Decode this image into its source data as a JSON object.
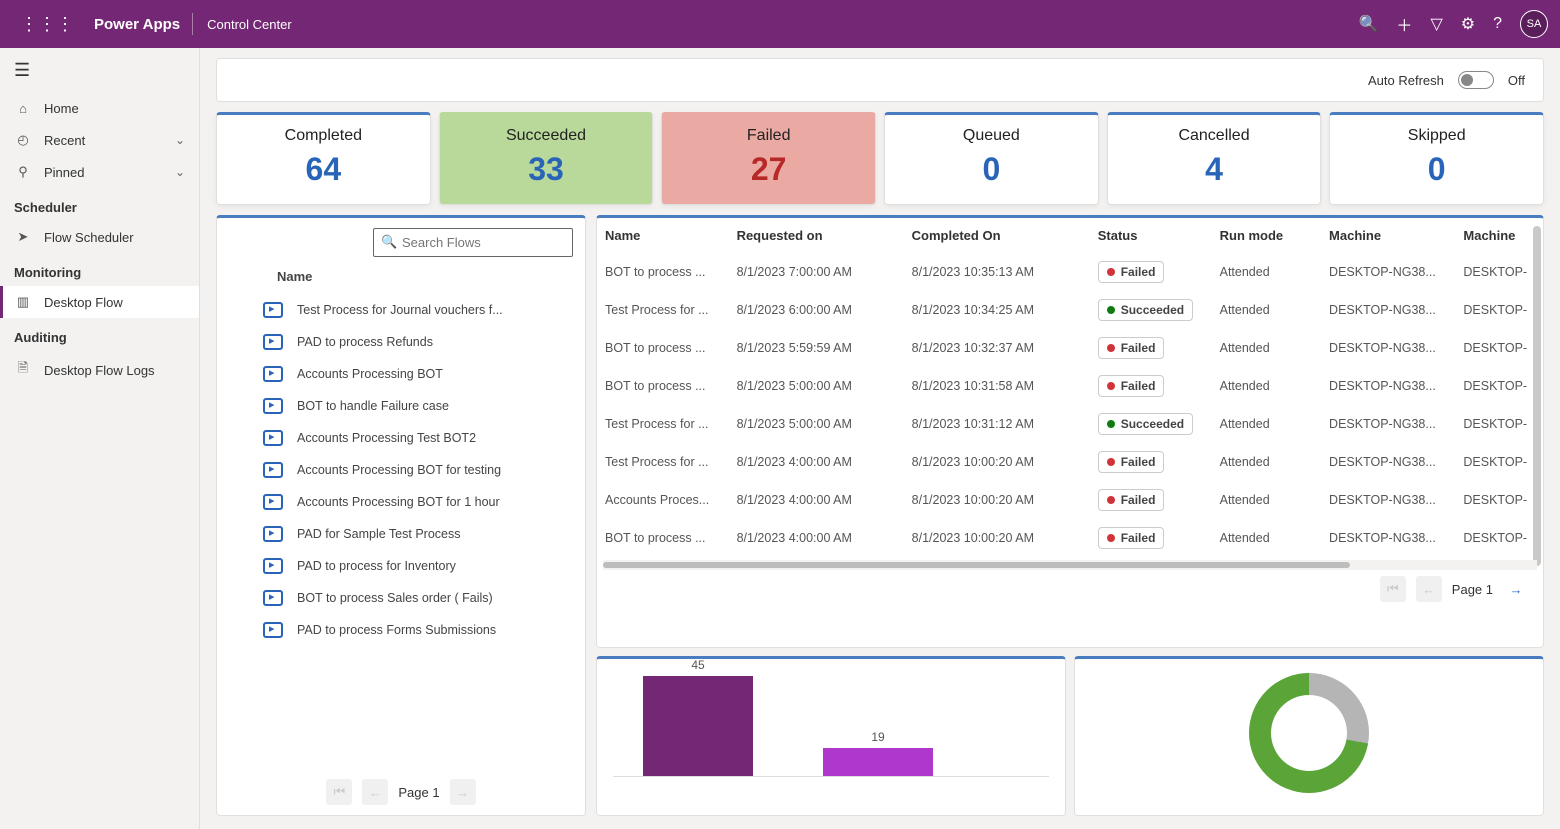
{
  "topbar": {
    "app_name": "Power Apps",
    "page_name": "Control Center",
    "avatar": "SA"
  },
  "nav": {
    "items": [
      {
        "icon": "⌂",
        "label": "Home",
        "chevron": false
      },
      {
        "icon": "◴",
        "label": "Recent",
        "chevron": true
      },
      {
        "icon": "⚲",
        "label": "Pinned",
        "chevron": true
      }
    ],
    "sections": [
      {
        "title": "Scheduler",
        "items": [
          {
            "icon": "➤",
            "label": "Flow Scheduler"
          }
        ]
      },
      {
        "title": "Monitoring",
        "items": [
          {
            "icon": "▥",
            "label": "Desktop Flow",
            "selected": true
          }
        ]
      },
      {
        "title": "Auditing",
        "items": [
          {
            "icon": "🗎",
            "label": "Desktop Flow Logs"
          }
        ]
      }
    ]
  },
  "refresh": {
    "label": "Auto Refresh",
    "state": "Off"
  },
  "kpis": [
    {
      "title": "Completed",
      "value": "64",
      "cls": ""
    },
    {
      "title": "Succeeded",
      "value": "33",
      "cls": "green"
    },
    {
      "title": "Failed",
      "value": "27",
      "cls": "red"
    },
    {
      "title": "Queued",
      "value": "0",
      "cls": ""
    },
    {
      "title": "Cancelled",
      "value": "4",
      "cls": ""
    },
    {
      "title": "Skipped",
      "value": "0",
      "cls": ""
    }
  ],
  "search": {
    "placeholder": "Search Flows"
  },
  "flows_header": "Name",
  "flows": [
    "Test Process for Journal vouchers f...",
    "PAD to process Refunds",
    "Accounts Processing BOT",
    "BOT to handle Failure case",
    "Accounts Processing Test BOT2",
    "Accounts Processing BOT for testing",
    "Accounts Processing BOT for 1 hour",
    "PAD for Sample Test Process",
    "PAD to process for Inventory",
    "BOT to process Sales order ( Fails)",
    "PAD to process Forms Submissions"
  ],
  "pager_left": {
    "page_label": "Page 1"
  },
  "table": {
    "headers": [
      "Name",
      "Requested on",
      "Completed On",
      "Status",
      "Run mode",
      "Machine",
      "Machine"
    ],
    "rows": [
      {
        "name": "BOT to process ...",
        "req": "8/1/2023 7:00:00 AM",
        "comp": "8/1/2023 10:35:13 AM",
        "status": "Failed",
        "mode": "Attended",
        "m1": "DESKTOP-NG38...",
        "m2": "DESKTOP-"
      },
      {
        "name": "Test Process for ...",
        "req": "8/1/2023 6:00:00 AM",
        "comp": "8/1/2023 10:34:25 AM",
        "status": "Succeeded",
        "mode": "Attended",
        "m1": "DESKTOP-NG38...",
        "m2": "DESKTOP-"
      },
      {
        "name": "BOT to process ...",
        "req": "8/1/2023 5:59:59 AM",
        "comp": "8/1/2023 10:32:37 AM",
        "status": "Failed",
        "mode": "Attended",
        "m1": "DESKTOP-NG38...",
        "m2": "DESKTOP-"
      },
      {
        "name": "BOT to process ...",
        "req": "8/1/2023 5:00:00 AM",
        "comp": "8/1/2023 10:31:58 AM",
        "status": "Failed",
        "mode": "Attended",
        "m1": "DESKTOP-NG38...",
        "m2": "DESKTOP-"
      },
      {
        "name": "Test Process for ...",
        "req": "8/1/2023 5:00:00 AM",
        "comp": "8/1/2023 10:31:12 AM",
        "status": "Succeeded",
        "mode": "Attended",
        "m1": "DESKTOP-NG38...",
        "m2": "DESKTOP-"
      },
      {
        "name": "Test Process for ...",
        "req": "8/1/2023 4:00:00 AM",
        "comp": "8/1/2023 10:00:20 AM",
        "status": "Failed",
        "mode": "Attended",
        "m1": "DESKTOP-NG38...",
        "m2": "DESKTOP-"
      },
      {
        "name": "Accounts Proces...",
        "req": "8/1/2023 4:00:00 AM",
        "comp": "8/1/2023 10:00:20 AM",
        "status": "Failed",
        "mode": "Attended",
        "m1": "DESKTOP-NG38...",
        "m2": "DESKTOP-"
      },
      {
        "name": "BOT to process ...",
        "req": "8/1/2023 4:00:00 AM",
        "comp": "8/1/2023 10:00:20 AM",
        "status": "Failed",
        "mode": "Attended",
        "m1": "DESKTOP-NG38...",
        "m2": "DESKTOP-"
      }
    ],
    "page_label": "Page 1"
  },
  "chart_data": [
    {
      "type": "bar",
      "categories": [
        "",
        ""
      ],
      "values": [
        45,
        19
      ],
      "title": "",
      "xlabel": "",
      "ylabel": "",
      "ylim": [
        0,
        50
      ],
      "colors": [
        "#742774",
        "#b037cd"
      ]
    },
    {
      "type": "pie",
      "series": [
        {
          "name": "grey",
          "value": 28
        },
        {
          "name": "green",
          "value": 72
        }
      ],
      "donut": true,
      "colors": [
        "#b5b5b5",
        "#5aa438"
      ]
    }
  ]
}
